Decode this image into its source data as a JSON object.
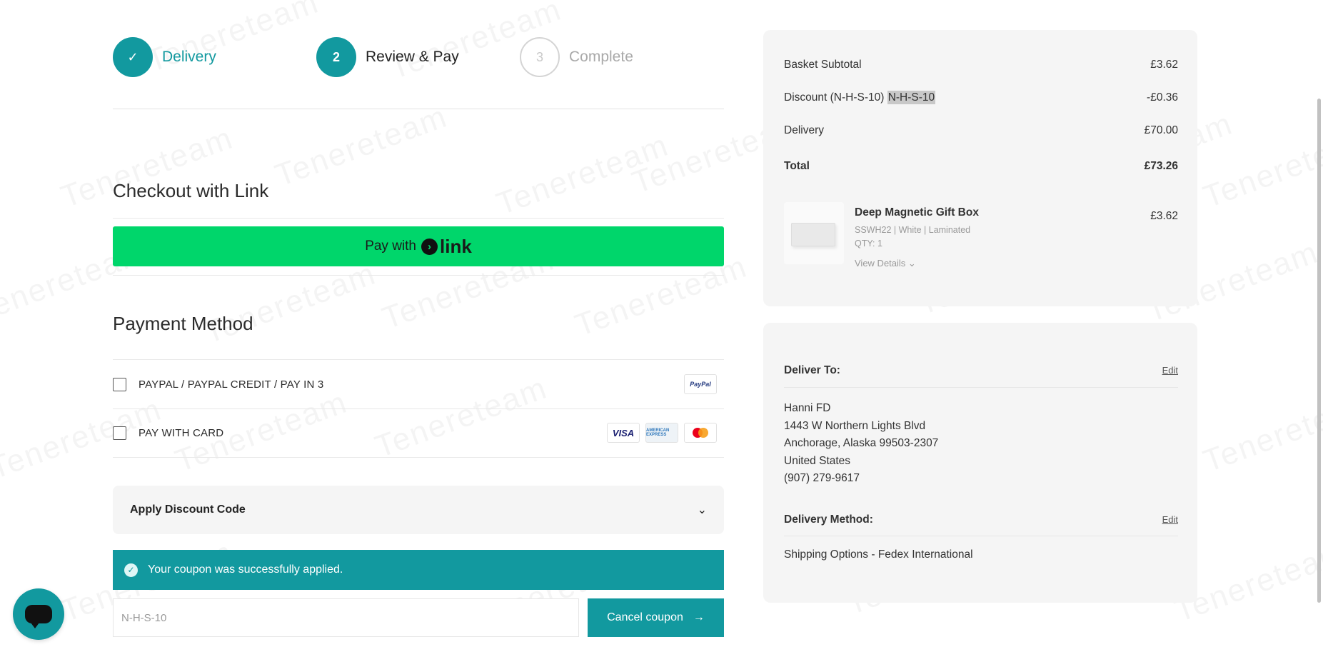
{
  "steps": [
    {
      "number": "✓",
      "label": "Delivery"
    },
    {
      "number": "2",
      "label": "Review & Pay"
    },
    {
      "number": "3",
      "label": "Complete"
    }
  ],
  "checkout_link": {
    "title": "Checkout with Link",
    "button_prefix": "Pay with",
    "button_brand": "link"
  },
  "payment": {
    "title": "Payment Method",
    "options": [
      {
        "label": "PAYPAL / PAYPAL CREDIT / PAY IN 3",
        "logos": [
          "paypal"
        ]
      },
      {
        "label": "PAY WITH CARD",
        "logos": [
          "visa",
          "amex",
          "mastercard"
        ]
      }
    ],
    "paypal_logo_text": "PayPal",
    "visa_logo_text": "VISA",
    "amex_logo_text": "AMERICAN EXPRESS"
  },
  "discount": {
    "accordion_label": "Apply Discount Code",
    "success_message": "Your coupon was successfully applied.",
    "code_value": "N-H-S-10",
    "cancel_label": "Cancel coupon"
  },
  "summary": {
    "rows": [
      {
        "label": "Basket Subtotal",
        "value": "£3.62"
      },
      {
        "label": "Discount (N-H-S-10)",
        "selected_text": "N-H-S-10",
        "value": "-£0.36"
      },
      {
        "label": "Delivery",
        "value": "£70.00"
      },
      {
        "label": "Total",
        "value": "£73.26"
      }
    ],
    "product": {
      "name": "Deep Magnetic Gift Box",
      "spec": "SSWH22 | White | Laminated",
      "qty": "QTY: 1",
      "details_label": "View Details",
      "price": "£3.62"
    }
  },
  "delivery": {
    "deliver_to_label": "Deliver To:",
    "edit_label": "Edit",
    "address_lines": [
      "Hanni FD",
      "1443 W Northern Lights Blvd",
      "Anchorage, Alaska 99503-2307",
      "United States",
      "(907) 279-9617"
    ],
    "method_label": "Delivery Method:",
    "method_value": "Shipping Options - Fedex International"
  },
  "watermark_text": "Tenereteam",
  "colors": {
    "accent": "#12999f",
    "link_green": "#00d66b",
    "panel_bg": "#f5f5f5"
  }
}
